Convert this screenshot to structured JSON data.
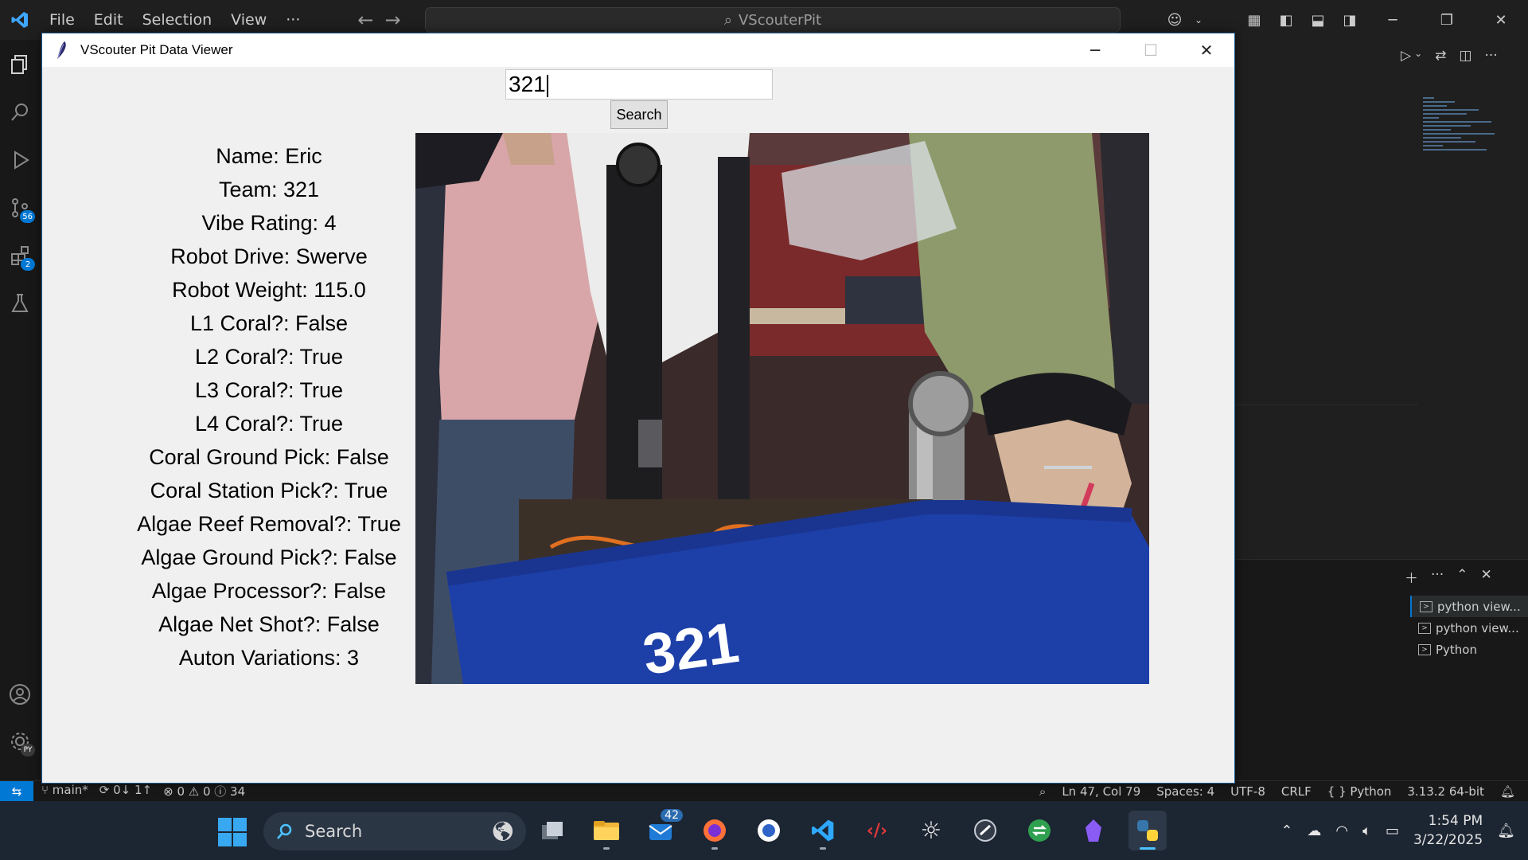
{
  "vscode": {
    "menu": [
      "File",
      "Edit",
      "Selection",
      "View",
      "···"
    ],
    "command_center": "VScouterPit",
    "activity_badges": {
      "source_control": "56",
      "extensions": "2"
    },
    "settings_badge": "PY",
    "terminals": [
      "python view...",
      "python view...",
      "Python"
    ],
    "status": {
      "branch": "main*",
      "sync": "0↓ 1↑",
      "problems": "⊗ 0 ⚠ 0 ⓘ 34",
      "position": "Ln 47, Col 79",
      "spaces": "Spaces: 4",
      "encoding": "UTF-8",
      "eol": "CRLF",
      "language": "{ } Python",
      "interpreter": "3.13.2 64-bit"
    }
  },
  "window": {
    "title": "VScouter Pit Data Viewer",
    "search_value": "321",
    "search_button": "Search",
    "fields": [
      "Name: Eric",
      "Team: 321",
      "Vibe Rating: 4",
      "Robot Drive: Swerve",
      "Robot Weight: 115.0",
      "L1 Coral?: False",
      "L2 Coral?: True",
      "L3 Coral?: True",
      "L4 Coral?: True",
      "Coral Ground Pick: False",
      "Coral Station Pick?: True",
      "Algae Reef Removal?: True",
      "Algae Ground Pick?: False",
      "Algae Processor?: False",
      "Algae Net Shot?: False",
      "Auton Variations: 3"
    ],
    "photo_bumper_number": "321"
  },
  "taskbar": {
    "search_placeholder": "Search",
    "mail_badge": "42",
    "time": "1:54 PM",
    "date": "3/22/2025"
  },
  "colors": {
    "vscode_bg": "#1f1f1f",
    "accent": "#0078d4",
    "taskbar_bg": "#1c2532",
    "tk_bg": "#f0f0f0"
  }
}
